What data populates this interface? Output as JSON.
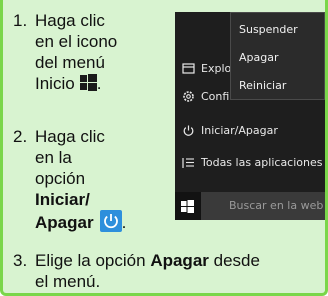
{
  "step1": {
    "num": "1.",
    "lines": [
      "Haga clic",
      "en el icono",
      "del menú",
      "Inicio"
    ]
  },
  "step2": {
    "num": "2.",
    "lines": [
      "Haga clic",
      "en la",
      "opción"
    ],
    "bold_lines": [
      "Iniciar/",
      "Apagar"
    ]
  },
  "step3": {
    "num": "3.",
    "pre": "Elige la opción",
    "bold": "Apagar",
    "post": "desde",
    "line2": "el menú."
  },
  "start_menu": {
    "items": [
      {
        "label": "Explo",
        "icon": "file-explorer-icon"
      },
      {
        "label": "Confi",
        "icon": "settings-gear-icon"
      },
      {
        "label": "Iniciar/Apagar",
        "icon": "power-icon"
      },
      {
        "label": "Todas las aplicaciones",
        "icon": "all-apps-list-icon"
      }
    ],
    "power_options": [
      "Suspender",
      "Apagar",
      "Reiniciar"
    ],
    "search_placeholder": "Buscar en la web"
  },
  "colors": {
    "card_bg": "#d8f3d0",
    "border": "#7ad64a",
    "menu_bg": "#1e1e1e",
    "power_icon_bg": "#2e8fdc"
  }
}
